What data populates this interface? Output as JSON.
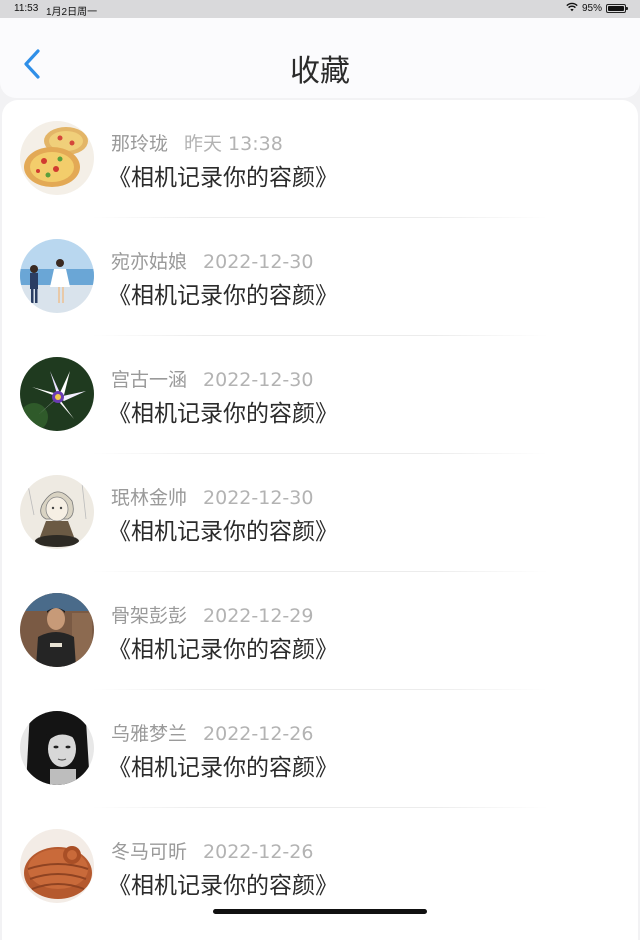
{
  "status_bar": {
    "time": "11:53",
    "date": "1月2日周一",
    "battery": "95%",
    "battery_level": 0.95
  },
  "header": {
    "title": "收藏",
    "back_icon": "chevron-left-icon",
    "accent_color": "#2f8fe8"
  },
  "items": [
    {
      "name": "那玲珑",
      "time": "昨天 13:38",
      "title": "《相机记录你的容颜》",
      "avatar": "food-pizza"
    },
    {
      "name": "宛亦姑娘",
      "time": "2022-12-30",
      "title": "《相机记录你的容颜》",
      "avatar": "couple-beach"
    },
    {
      "name": "宫古一涵",
      "time": "2022-12-30",
      "title": "《相机记录你的容颜》",
      "avatar": "purple-flower"
    },
    {
      "name": "珉林金帅",
      "time": "2022-12-30",
      "title": "《相机记录你的容颜》",
      "avatar": "anime-sketch"
    },
    {
      "name": "骨架彭彭",
      "time": "2022-12-29",
      "title": "《相机记录你的容颜》",
      "avatar": "man-portrait"
    },
    {
      "name": "乌雅梦兰",
      "time": "2022-12-26",
      "title": "《相机记录你的容颜》",
      "avatar": "woman-bw"
    },
    {
      "name": "冬马可昕",
      "time": "2022-12-26",
      "title": "《相机记录你的容颜》",
      "avatar": "knitted-hat"
    }
  ]
}
